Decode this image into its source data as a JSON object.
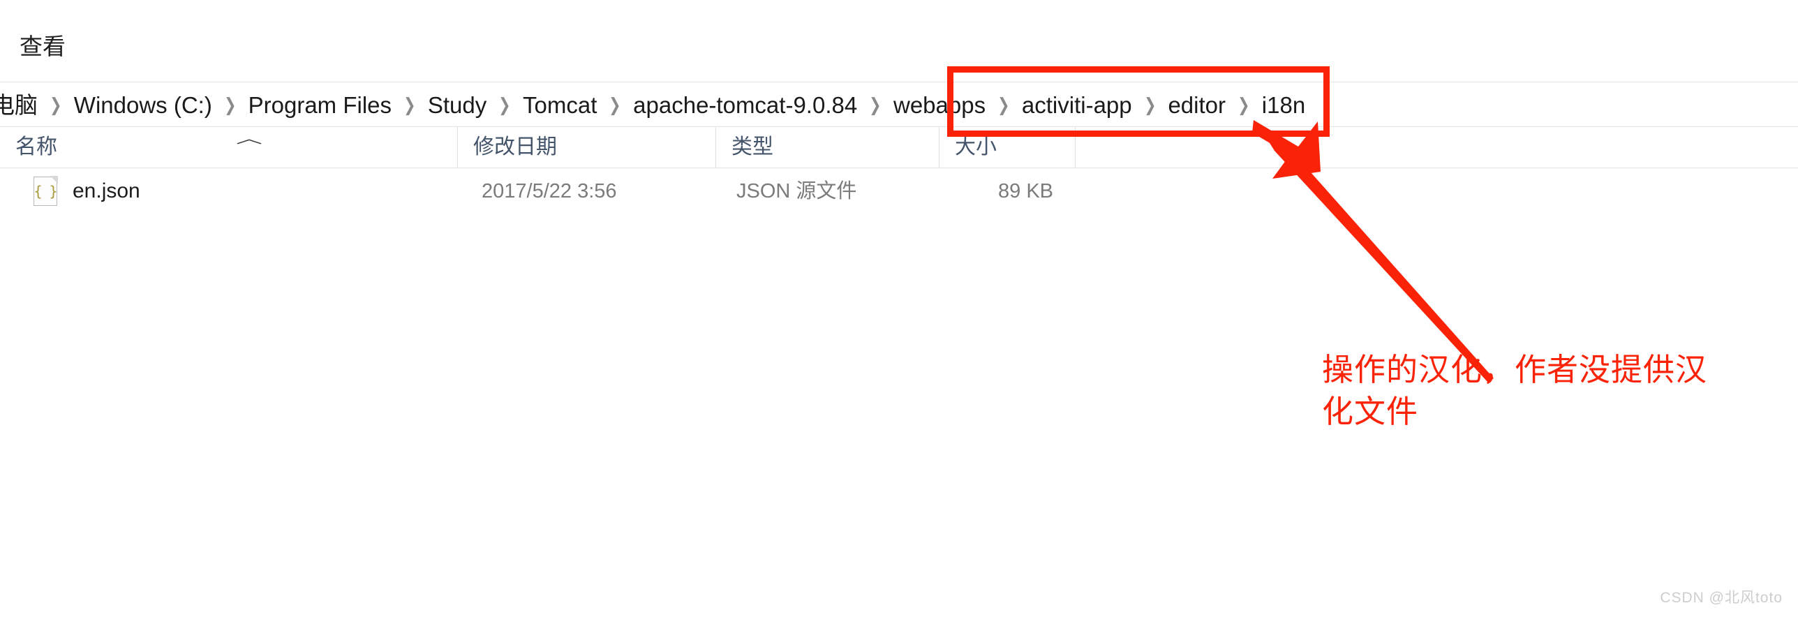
{
  "window": {
    "background_color": "#ffffff"
  },
  "ribbon": {
    "view_menu_label": "查看"
  },
  "address": {
    "breadcrumb": [
      {
        "label": "电脑",
        "highlighted": false
      },
      {
        "label": "Windows (C:)",
        "highlighted": false
      },
      {
        "label": "Program Files",
        "highlighted": false
      },
      {
        "label": "Study",
        "highlighted": false
      },
      {
        "label": "Tomcat",
        "highlighted": false
      },
      {
        "label": "apache-tomcat-9.0.84",
        "highlighted": false
      },
      {
        "label": "webapps",
        "highlighted": false
      },
      {
        "label": "activiti-app",
        "highlighted": true
      },
      {
        "label": "editor",
        "highlighted": true
      },
      {
        "label": "i18n",
        "highlighted": true
      }
    ],
    "separator": "❯"
  },
  "columns": {
    "headers": [
      {
        "label": "名称",
        "sort": "ascending"
      },
      {
        "label": "修改日期",
        "sort": ""
      },
      {
        "label": "类型",
        "sort": ""
      },
      {
        "label": "大小",
        "sort": ""
      }
    ],
    "sort_caret_glyph": "︿",
    "header_color": "#44546a"
  },
  "files": {
    "rows": [
      {
        "name": "en.json",
        "date_modified": "2017/5/22 3:56",
        "type": "JSON 源文件",
        "size": "89 KB",
        "icon": "json-file-icon",
        "icon_glyph": "{ }"
      }
    ]
  },
  "annotation": {
    "accent_color": "#fa2207",
    "note_line_1": "操作的汉化，作者没提供汉",
    "note_line_2": "化文件",
    "note_full": "操作的汉化，作者没提供汉化文件",
    "highlight_target": "activiti-app > editor > i18n"
  },
  "watermark": {
    "text": "CSDN @北风toto"
  }
}
